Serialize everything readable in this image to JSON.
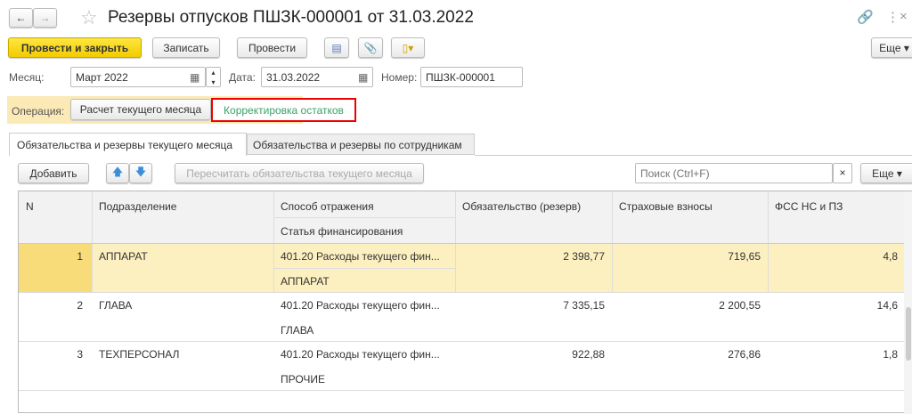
{
  "title": "Резервы отпусков ПШЗК-000001 от 31.03.2022",
  "toolbar": {
    "post_close": "Провести и закрыть",
    "save": "Записать",
    "post": "Провести",
    "more": "Еще"
  },
  "fields": {
    "month_label": "Месяц:",
    "month_value": "Март 2022",
    "date_label": "Дата:",
    "date_value": "31.03.2022",
    "number_label": "Номер:",
    "number_value": "ПШЗК-000001"
  },
  "operation": {
    "label": "Операция:",
    "options": [
      "Расчет текущего месяца",
      "Корректировка остатков"
    ]
  },
  "tabs": [
    "Обязательства и резервы текущего месяца",
    "Обязательства и резервы по сотрудникам"
  ],
  "table_toolbar": {
    "add": "Добавить",
    "recalc": "Пересчитать обязательства текущего месяца",
    "search_placeholder": "Поиск (Ctrl+F)",
    "clear": "×",
    "more": "Еще"
  },
  "columns": {
    "n": "N",
    "dept": "Подразделение",
    "method": "Способ отражения",
    "funding": "Статья финансирования",
    "liability": "Обязательство (резерв)",
    "insurance": "Страховые взносы",
    "fss": "ФСС НС и ПЗ"
  },
  "rows": [
    {
      "n": "1",
      "dept": "АППАРАТ",
      "method": "401.20 Расходы текущего фин...",
      "funding": "АППАРАТ",
      "liability": "2 398,77",
      "insurance": "719,65",
      "fss": "4,8"
    },
    {
      "n": "2",
      "dept": "ГЛАВА",
      "method": "401.20 Расходы текущего фин...",
      "funding": "ГЛАВА",
      "liability": "7 335,15",
      "insurance": "2 200,55",
      "fss": "14,6"
    },
    {
      "n": "3",
      "dept": "ТЕХПЕРСОНАЛ",
      "method": "401.20 Расходы текущего фин...",
      "funding": "ПРОЧИЕ",
      "liability": "922,88",
      "insurance": "276,86",
      "fss": "1,8"
    }
  ]
}
